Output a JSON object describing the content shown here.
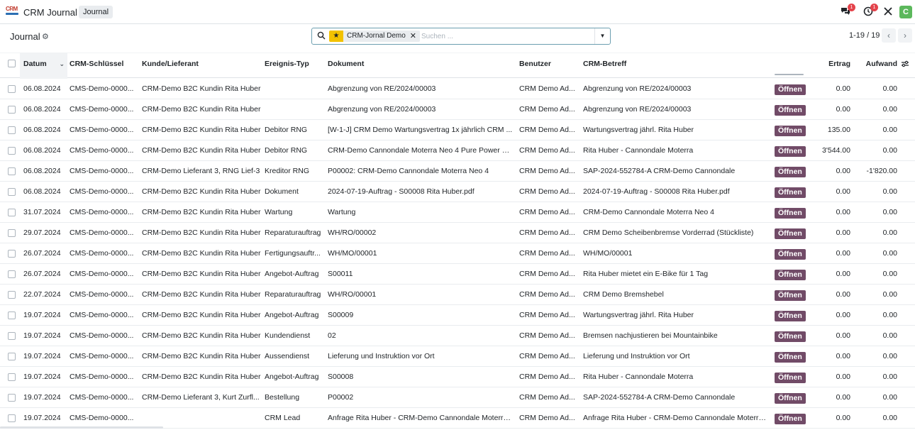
{
  "navbar": {
    "logo_text": "CRM",
    "app_title": "CRM Journal",
    "breadcrumb": "Journal",
    "chat_badge": "1",
    "activity_badge": "1",
    "avatar_letter": "C"
  },
  "control": {
    "title": "Journal",
    "facet_label": "CRM-Jornal Demo",
    "search_placeholder": "Suchen ...",
    "pager": "1-19 / 19"
  },
  "columns": {
    "date": "Datum",
    "key": "CRM-Schlüssel",
    "partner": "Kunde/Lieferant",
    "event": "Ereignis-Typ",
    "document": "Dokument",
    "user": "Benutzer",
    "subject": "CRM-Betreff",
    "income": "Ertrag",
    "expense": "Aufwand"
  },
  "open_label": "Öffnen",
  "rows": [
    {
      "date": "06.08.2024",
      "key": "CMS-Demo-0000...",
      "partner": "CRM-Demo B2C Kundin Rita Huber",
      "event": "",
      "document": "Abgrenzung von RE/2024/00003",
      "user": "CRM Demo Ad...",
      "subject": "Abgrenzung von RE/2024/00003",
      "income": "0.00",
      "expense": "0.00"
    },
    {
      "date": "06.08.2024",
      "key": "CMS-Demo-0000...",
      "partner": "CRM-Demo B2C Kundin Rita Huber",
      "event": "",
      "document": "Abgrenzung von RE/2024/00003",
      "user": "CRM Demo Ad...",
      "subject": "Abgrenzung von RE/2024/00003",
      "income": "0.00",
      "expense": "0.00"
    },
    {
      "date": "06.08.2024",
      "key": "CMS-Demo-0000...",
      "partner": "CRM-Demo B2C Kundin Rita Huber",
      "event": "Debitor RNG",
      "document": "[W-1-J] CRM Demo Wartungsvertrag 1x jährlich CRM ...",
      "user": "CRM Demo Ad...",
      "subject": "Wartungsvertrag jährl. Rita Huber",
      "income": "135.00",
      "expense": "0.00"
    },
    {
      "date": "06.08.2024",
      "key": "CMS-Demo-0000...",
      "partner": "CRM-Demo B2C Kundin Rita Huber",
      "event": "Debitor RNG",
      "document": "CRM-Demo Cannondale Moterra Neo 4 Pure Power Me...",
      "user": "CRM Demo Ad...",
      "subject": "Rita Huber - Cannondale Moterra",
      "income": "3'544.00",
      "expense": "0.00"
    },
    {
      "date": "06.08.2024",
      "key": "CMS-Demo-0000...",
      "partner": "CRM-Demo Lieferant 3, RNG Lief-3",
      "event": "Kreditor RNG",
      "document": "P00002: CRM-Demo Cannondale Moterra Neo 4",
      "user": "CRM Demo Ad...",
      "subject": "SAP-2024-552784-A CRM-Demo Cannondale",
      "income": "0.00",
      "expense": "-1'820.00"
    },
    {
      "date": "06.08.2024",
      "key": "CMS-Demo-0000...",
      "partner": "CRM-Demo B2C Kundin Rita Huber",
      "event": "Dokument",
      "document": "2024-07-19-Auftrag - S00008 Rita Huber.pdf",
      "user": "CRM Demo Ad...",
      "subject": "2024-07-19-Auftrag - S00008 Rita Huber.pdf",
      "income": "0.00",
      "expense": "0.00"
    },
    {
      "date": "31.07.2024",
      "key": "CMS-Demo-0000...",
      "partner": "CRM-Demo B2C Kundin Rita Huber",
      "event": "Wartung",
      "document": "Wartung",
      "user": "CRM Demo Ad...",
      "subject": "CRM-Demo Cannondale Moterra Neo 4",
      "income": "0.00",
      "expense": "0.00"
    },
    {
      "date": "29.07.2024",
      "key": "CMS-Demo-0000...",
      "partner": "CRM-Demo B2C Kundin Rita Huber",
      "event": "Reparaturauftrag",
      "document": "WH/RO/00002",
      "user": "CRM Demo Ad...",
      "subject": "CRM Demo Scheibenbremse Vorderrad (Stückliste)",
      "income": "0.00",
      "expense": "0.00"
    },
    {
      "date": "26.07.2024",
      "key": "CMS-Demo-0000...",
      "partner": "CRM-Demo B2C Kundin Rita Huber",
      "event": "Fertigungsauftr...",
      "document": "WH/MO/00001",
      "user": "CRM Demo Ad...",
      "subject": "WH/MO/00001",
      "income": "0.00",
      "expense": "0.00"
    },
    {
      "date": "26.07.2024",
      "key": "CMS-Demo-0000...",
      "partner": "CRM-Demo B2C Kundin Rita Huber",
      "event": "Angebot-Auftrag",
      "document": "S00011",
      "user": "CRM Demo Ad...",
      "subject": "Rita Huber mietet ein E-Bike für 1 Tag",
      "income": "0.00",
      "expense": "0.00"
    },
    {
      "date": "22.07.2024",
      "key": "CMS-Demo-0000...",
      "partner": "CRM-Demo B2C Kundin Rita Huber",
      "event": "Reparaturauftrag",
      "document": "WH/RO/00001",
      "user": "CRM Demo Ad...",
      "subject": "CRM Demo Bremshebel",
      "income": "0.00",
      "expense": "0.00"
    },
    {
      "date": "19.07.2024",
      "key": "CMS-Demo-0000...",
      "partner": "CRM-Demo B2C Kundin Rita Huber",
      "event": "Angebot-Auftrag",
      "document": "S00009",
      "user": "CRM Demo Ad...",
      "subject": "Wartungsvertrag jährl. Rita Huber",
      "income": "0.00",
      "expense": "0.00"
    },
    {
      "date": "19.07.2024",
      "key": "CMS-Demo-0000...",
      "partner": "CRM-Demo B2C Kundin Rita Huber",
      "event": "Kundendienst",
      "document": "02",
      "user": "CRM Demo Ad...",
      "subject": "Bremsen nachjustieren bei Mountainbike",
      "income": "0.00",
      "expense": "0.00"
    },
    {
      "date": "19.07.2024",
      "key": "CMS-Demo-0000...",
      "partner": "CRM-Demo B2C Kundin Rita Huber",
      "event": "Aussendienst",
      "document": "Lieferung und Instruktion vor Ort",
      "user": "CRM Demo Ad...",
      "subject": "Lieferung und Instruktion vor Ort",
      "income": "0.00",
      "expense": "0.00"
    },
    {
      "date": "19.07.2024",
      "key": "CMS-Demo-0000...",
      "partner": "CRM-Demo B2C Kundin Rita Huber",
      "event": "Angebot-Auftrag",
      "document": "S00008",
      "user": "CRM Demo Ad...",
      "subject": "Rita Huber - Cannondale Moterra",
      "income": "0.00",
      "expense": "0.00"
    },
    {
      "date": "19.07.2024",
      "key": "CMS-Demo-0000...",
      "partner": "CRM-Demo Lieferant 3, Kurt Zurfl...",
      "event": "Bestellung",
      "document": "P00002",
      "user": "CRM Demo Ad...",
      "subject": "SAP-2024-552784-A CRM-Demo Cannondale",
      "income": "0.00",
      "expense": "0.00"
    },
    {
      "date": "19.07.2024",
      "key": "CMS-Demo-0000...",
      "partner": "",
      "event": "CRM Lead",
      "document": "Anfrage Rita Huber - CRM-Demo Cannondale Moterra ...",
      "user": "CRM Demo Ad...",
      "subject": "Anfrage Rita Huber - CRM-Demo Cannondale Moterra ...",
      "income": "0.00",
      "expense": "0.00"
    }
  ]
}
